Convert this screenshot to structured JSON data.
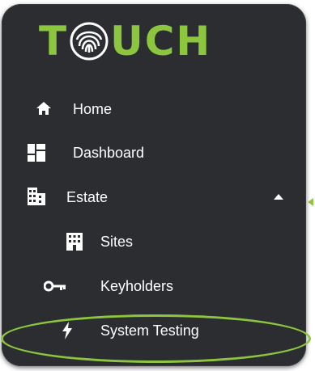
{
  "logo": {
    "text_left": "T",
    "text_right": "UCH",
    "accent_color": "#8cc63f"
  },
  "menu": {
    "items": [
      {
        "label": "Home",
        "icon": "home-icon"
      },
      {
        "label": "Dashboard",
        "icon": "dashboard-icon"
      },
      {
        "label": "Estate",
        "icon": "building-icon",
        "expanded": true
      },
      {
        "label": "Sites",
        "icon": "sites-icon"
      },
      {
        "label": "Keyholders",
        "icon": "key-icon"
      },
      {
        "label": "System Testing",
        "icon": "lightning-icon",
        "highlighted": true
      }
    ]
  },
  "colors": {
    "panel_background": "#2b2d31",
    "text": "#ffffff",
    "highlight": "#8cc63f"
  }
}
